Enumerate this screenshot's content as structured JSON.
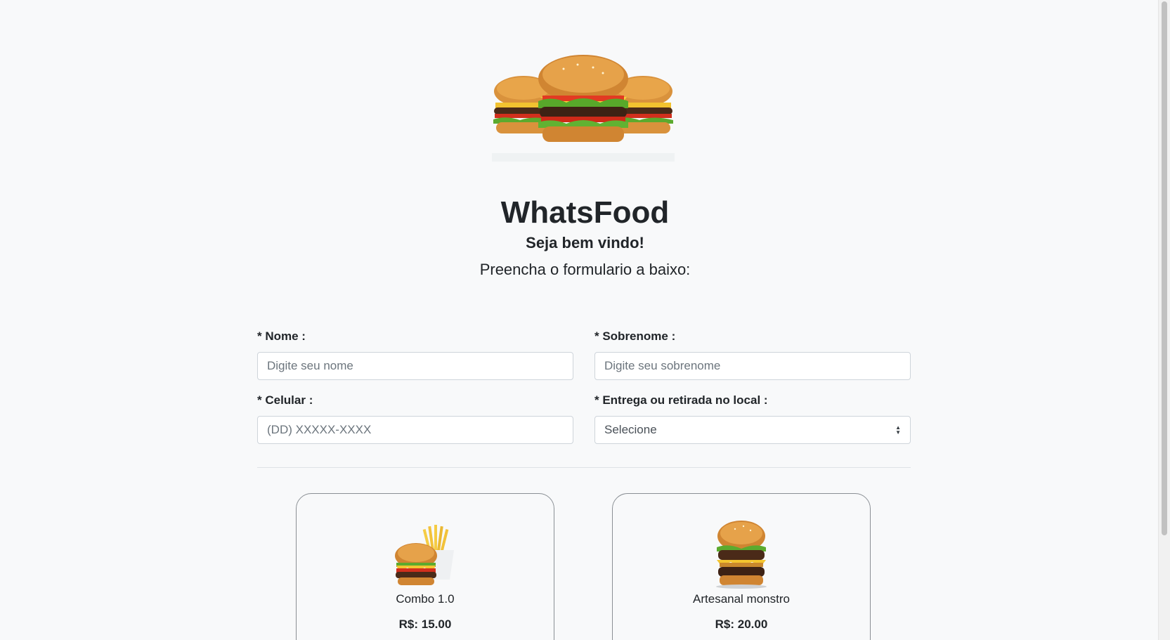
{
  "header": {
    "hero_image": "three-burgers-image",
    "title": "WhatsFood",
    "welcome": "Seja bem vindo!",
    "instruction": "Preencha o formulario a baixo:"
  },
  "form": {
    "nome": {
      "label": "* Nome :",
      "placeholder": "Digite seu nome"
    },
    "sobrenome": {
      "label": "* Sobrenome :",
      "placeholder": "Digite seu sobrenome"
    },
    "celular": {
      "label": "* Celular :",
      "placeholder": "(DD) XXXXX-XXXX"
    },
    "entrega": {
      "label": "* Entrega ou retirada no local :",
      "selected": "Selecione"
    }
  },
  "products": [
    {
      "name": "Combo 1.0",
      "price": "R$: 15.00",
      "image": "burger-fries-combo-image"
    },
    {
      "name": "Artesanal monstro",
      "price": "R$: 20.00",
      "image": "double-burger-image"
    }
  ]
}
